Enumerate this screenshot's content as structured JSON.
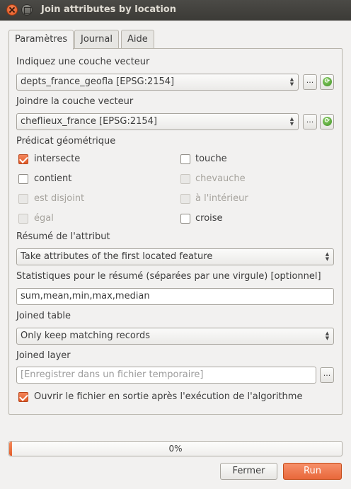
{
  "window": {
    "title": "Join attributes by location"
  },
  "tabs": [
    {
      "label": "Paramètres",
      "active": true
    },
    {
      "label": "Journal",
      "active": false
    },
    {
      "label": "Aide",
      "active": false
    }
  ],
  "params": {
    "input_layer": {
      "label": "Indiquez une couche vecteur",
      "value": "depts_france_geofla [EPSG:2154]"
    },
    "join_layer": {
      "label": "Joindre la couche vecteur",
      "value": "cheflieux_france [EPSG:2154]"
    },
    "browse_label": "...",
    "predicate": {
      "label": "Prédicat géométrique",
      "options": [
        {
          "label": "intersecte",
          "checked": true,
          "enabled": true
        },
        {
          "label": "touche",
          "checked": false,
          "enabled": true
        },
        {
          "label": "contient",
          "checked": false,
          "enabled": true
        },
        {
          "label": "chevauche",
          "checked": false,
          "enabled": false
        },
        {
          "label": "est disjoint",
          "checked": false,
          "enabled": false
        },
        {
          "label": "à l'intérieur",
          "checked": false,
          "enabled": false
        },
        {
          "label": "égal",
          "checked": false,
          "enabled": false
        },
        {
          "label": "croise",
          "checked": false,
          "enabled": true
        }
      ]
    },
    "summary": {
      "label": "Résumé de l'attribut",
      "value": "Take attributes of the first located feature"
    },
    "statistics": {
      "label": "Statistiques pour le résumé (séparées par une virgule) [optionnel]",
      "value": "sum,mean,min,max,median"
    },
    "joined_table": {
      "label": "Joined table",
      "value": "Only keep matching records"
    },
    "joined_layer": {
      "label": "Joined layer",
      "placeholder": "[Enregistrer dans un fichier temporaire]"
    },
    "open_output": {
      "label": "Ouvrir le fichier en sortie après l'exécution de l'algorithme",
      "checked": true
    }
  },
  "progress": {
    "value": 0,
    "text": "0%"
  },
  "buttons": {
    "close": "Fermer",
    "run": "Run"
  },
  "colors": {
    "accent": "#e45d2a",
    "titlebar": "#3c3b37"
  }
}
